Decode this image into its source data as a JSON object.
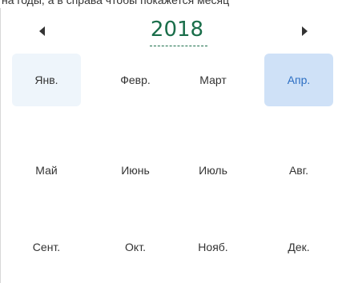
{
  "top_text": "на годы, а в справа чтобы покажется месяц",
  "year": "2018",
  "nav": {
    "prev_icon": "chevron-left-icon",
    "next_icon": "chevron-right-icon"
  },
  "months": [
    {
      "label": "Янв.",
      "state": "current"
    },
    {
      "label": "Февр.",
      "state": "normal"
    },
    {
      "label": "Март",
      "state": "normal"
    },
    {
      "label": "Апр.",
      "state": "selected"
    },
    {
      "label": "Май",
      "state": "normal"
    },
    {
      "label": "Июнь",
      "state": "normal"
    },
    {
      "label": "Июль",
      "state": "normal"
    },
    {
      "label": "Авг.",
      "state": "normal"
    },
    {
      "label": "Сент.",
      "state": "normal"
    },
    {
      "label": "Окт.",
      "state": "normal"
    },
    {
      "label": "Нояб.",
      "state": "normal"
    },
    {
      "label": "Дек.",
      "state": "normal"
    }
  ],
  "colors": {
    "year_text": "#1a6e4a",
    "current_bg": "#eef5fb",
    "selected_bg": "#cfe1f7",
    "selected_text": "#2b6dc2"
  }
}
